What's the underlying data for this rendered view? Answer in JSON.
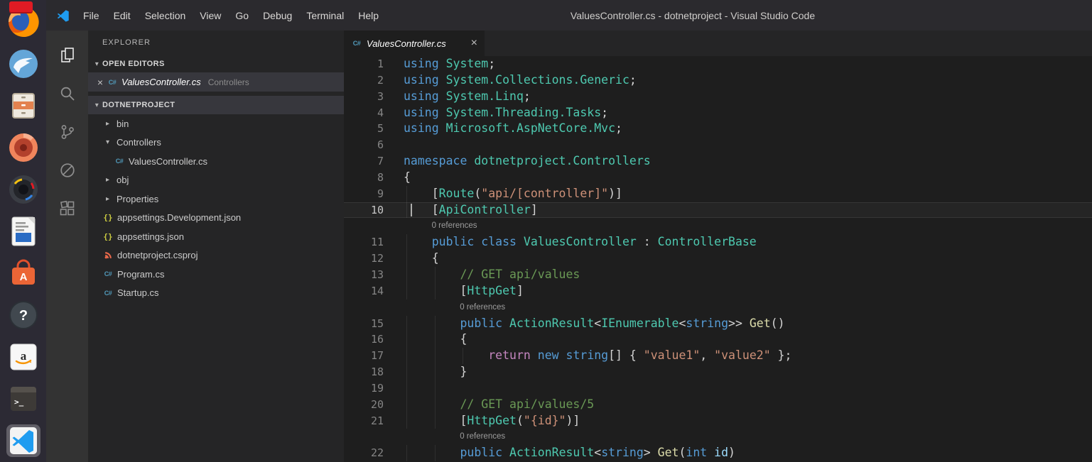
{
  "colors": {
    "tokens": {
      "kw": "#569CD6",
      "ty": "#4EC9B0",
      "st": "#CE9178",
      "cm": "#6A9955",
      "ct": "#C586C0",
      "fn": "#DCDCAA",
      "va": "#9CDCFE",
      "pl": "#D4D4D4"
    },
    "ui": {
      "editor_bg": "#1E1E1E",
      "sidebar_bg": "#252526",
      "activitybar_bg": "#333333",
      "titlebar_bg": "#2B2A2E",
      "launcher_bg": "#2C2A34",
      "selection_bg": "#37373D",
      "indicator_red": "#E01B24",
      "accent": "#1F9CF0"
    }
  },
  "launcher": {
    "items": [
      {
        "id": "firefox",
        "label": "Firefox"
      },
      {
        "id": "thunderbird",
        "label": "Thunderbird"
      },
      {
        "id": "files",
        "label": "Files"
      },
      {
        "id": "rhythmbox",
        "label": "Rhythmbox"
      },
      {
        "id": "shotwell",
        "label": "Shotwell"
      },
      {
        "id": "libreoffice-writer",
        "label": "LibreOffice Writer"
      },
      {
        "id": "ubuntu-software",
        "label": "Ubuntu Software"
      },
      {
        "id": "help",
        "label": "Help"
      },
      {
        "id": "amazon",
        "label": "Amazon"
      },
      {
        "id": "terminal",
        "label": "Terminal"
      },
      {
        "id": "vscode",
        "label": "Visual Studio Code",
        "active": true
      }
    ]
  },
  "titlebar": {
    "menus": [
      "File",
      "Edit",
      "Selection",
      "View",
      "Go",
      "Debug",
      "Terminal",
      "Help"
    ],
    "title": "ValuesController.cs - dotnetproject - Visual Studio Code"
  },
  "activitybar": {
    "items": [
      {
        "id": "explorer",
        "active": true
      },
      {
        "id": "search",
        "active": false
      },
      {
        "id": "source-control",
        "active": false
      },
      {
        "id": "debug",
        "active": false
      },
      {
        "id": "extensions",
        "active": false
      }
    ]
  },
  "explorer": {
    "title": "EXPLORER",
    "open_editors": {
      "header": "OPEN EDITORS",
      "items": [
        {
          "name": "ValuesController.cs",
          "detail": "Controllers",
          "kind": "csharp",
          "selected": true
        }
      ]
    },
    "tree": {
      "header": "DOTNETPROJECT",
      "items": [
        {
          "label": "bin",
          "kind": "folder",
          "state": "collapsed",
          "depth": 0
        },
        {
          "label": "Controllers",
          "kind": "folder",
          "state": "expanded",
          "depth": 0
        },
        {
          "label": "ValuesController.cs",
          "kind": "csharp",
          "depth": 1
        },
        {
          "label": "obj",
          "kind": "folder",
          "state": "collapsed",
          "depth": 0
        },
        {
          "label": "Properties",
          "kind": "folder",
          "state": "collapsed",
          "depth": 0
        },
        {
          "label": "appsettings.Development.json",
          "kind": "json",
          "depth": 0
        },
        {
          "label": "appsettings.json",
          "kind": "json",
          "depth": 0
        },
        {
          "label": "dotnetproject.csproj",
          "kind": "csproj",
          "depth": 0
        },
        {
          "label": "Program.cs",
          "kind": "csharp",
          "depth": 0
        },
        {
          "label": "Startup.cs",
          "kind": "csharp",
          "depth": 0
        }
      ]
    }
  },
  "editor": {
    "tab": {
      "label": "ValuesController.cs"
    },
    "codelens_label": "0 references",
    "rows": [
      {
        "n": 1,
        "t": [
          [
            "kw",
            "using"
          ],
          [
            "pl",
            " "
          ],
          [
            "ty",
            "System"
          ],
          [
            "pl",
            ";"
          ]
        ]
      },
      {
        "n": 2,
        "t": [
          [
            "kw",
            "using"
          ],
          [
            "pl",
            " "
          ],
          [
            "ty",
            "System.Collections.Generic"
          ],
          [
            "pl",
            ";"
          ]
        ]
      },
      {
        "n": 3,
        "t": [
          [
            "kw",
            "using"
          ],
          [
            "pl",
            " "
          ],
          [
            "ty",
            "System.Linq"
          ],
          [
            "pl",
            ";"
          ]
        ]
      },
      {
        "n": 4,
        "t": [
          [
            "kw",
            "using"
          ],
          [
            "pl",
            " "
          ],
          [
            "ty",
            "System.Threading.Tasks"
          ],
          [
            "pl",
            ";"
          ]
        ]
      },
      {
        "n": 5,
        "t": [
          [
            "kw",
            "using"
          ],
          [
            "pl",
            " "
          ],
          [
            "ty",
            "Microsoft.AspNetCore.Mvc"
          ],
          [
            "pl",
            ";"
          ]
        ]
      },
      {
        "n": 6,
        "t": []
      },
      {
        "n": 7,
        "t": [
          [
            "kw",
            "namespace"
          ],
          [
            "pl",
            " "
          ],
          [
            "ty",
            "dotnetproject.Controllers"
          ]
        ]
      },
      {
        "n": 8,
        "t": [
          [
            "pl",
            "{"
          ]
        ]
      },
      {
        "n": 9,
        "g": [
          0
        ],
        "t": [
          [
            "pl",
            "    ["
          ],
          [
            "ty",
            "Route"
          ],
          [
            "pl",
            "("
          ],
          [
            "st",
            "\"api/[controller]\""
          ],
          [
            "pl",
            ")]"
          ]
        ]
      },
      {
        "n": 10,
        "g": [
          0
        ],
        "cur": true,
        "t": [
          [
            "pl",
            "    ["
          ],
          [
            "ty",
            "ApiController"
          ],
          [
            "pl",
            "]"
          ]
        ]
      },
      {
        "lens": "0 references",
        "ind": 4
      },
      {
        "n": 11,
        "g": [
          0
        ],
        "t": [
          [
            "pl",
            "    "
          ],
          [
            "kw",
            "public"
          ],
          [
            "pl",
            " "
          ],
          [
            "kw",
            "class"
          ],
          [
            "pl",
            " "
          ],
          [
            "ty",
            "ValuesController"
          ],
          [
            "pl",
            " : "
          ],
          [
            "ty",
            "ControllerBase"
          ]
        ]
      },
      {
        "n": 12,
        "g": [
          0
        ],
        "t": [
          [
            "pl",
            "    {"
          ]
        ]
      },
      {
        "n": 13,
        "g": [
          0,
          4
        ],
        "t": [
          [
            "pl",
            "        "
          ],
          [
            "cm",
            "// GET api/values"
          ]
        ]
      },
      {
        "n": 14,
        "g": [
          0,
          4
        ],
        "t": [
          [
            "pl",
            "        ["
          ],
          [
            "ty",
            "HttpGet"
          ],
          [
            "pl",
            "]"
          ]
        ]
      },
      {
        "lens": "0 references",
        "ind": 8
      },
      {
        "n": 15,
        "g": [
          0,
          4
        ],
        "t": [
          [
            "pl",
            "        "
          ],
          [
            "kw",
            "public"
          ],
          [
            "pl",
            " "
          ],
          [
            "ty",
            "ActionResult"
          ],
          [
            "pl",
            "<"
          ],
          [
            "ty",
            "IEnumerable"
          ],
          [
            "pl",
            "<"
          ],
          [
            "kw",
            "string"
          ],
          [
            "pl",
            ">> "
          ],
          [
            "fn",
            "Get"
          ],
          [
            "pl",
            "()"
          ]
        ]
      },
      {
        "n": 16,
        "g": [
          0,
          4
        ],
        "t": [
          [
            "pl",
            "        {"
          ]
        ]
      },
      {
        "n": 17,
        "g": [
          0,
          4,
          8
        ],
        "t": [
          [
            "pl",
            "            "
          ],
          [
            "ct",
            "return"
          ],
          [
            "pl",
            " "
          ],
          [
            "kw",
            "new"
          ],
          [
            "pl",
            " "
          ],
          [
            "kw",
            "string"
          ],
          [
            "pl",
            "[] { "
          ],
          [
            "st",
            "\"value1\""
          ],
          [
            "pl",
            ", "
          ],
          [
            "st",
            "\"value2\""
          ],
          [
            "pl",
            " };"
          ]
        ]
      },
      {
        "n": 18,
        "g": [
          0,
          4
        ],
        "t": [
          [
            "pl",
            "        }"
          ]
        ]
      },
      {
        "n": 19,
        "g": [
          0,
          4
        ],
        "t": []
      },
      {
        "n": 20,
        "g": [
          0,
          4
        ],
        "t": [
          [
            "pl",
            "        "
          ],
          [
            "cm",
            "// GET api/values/5"
          ]
        ]
      },
      {
        "n": 21,
        "g": [
          0,
          4
        ],
        "t": [
          [
            "pl",
            "        ["
          ],
          [
            "ty",
            "HttpGet"
          ],
          [
            "pl",
            "("
          ],
          [
            "st",
            "\"{id}\""
          ],
          [
            "pl",
            ")]"
          ]
        ]
      },
      {
        "lens": "0 references",
        "ind": 8
      },
      {
        "n": 22,
        "g": [
          0,
          4
        ],
        "t": [
          [
            "pl",
            "        "
          ],
          [
            "kw",
            "public"
          ],
          [
            "pl",
            " "
          ],
          [
            "ty",
            "ActionResult"
          ],
          [
            "pl",
            "<"
          ],
          [
            "kw",
            "string"
          ],
          [
            "pl",
            "> "
          ],
          [
            "fn",
            "Get"
          ],
          [
            "pl",
            "("
          ],
          [
            "kw",
            "int"
          ],
          [
            "pl",
            " "
          ],
          [
            "va",
            "id"
          ],
          [
            "pl",
            ")"
          ]
        ]
      }
    ]
  }
}
